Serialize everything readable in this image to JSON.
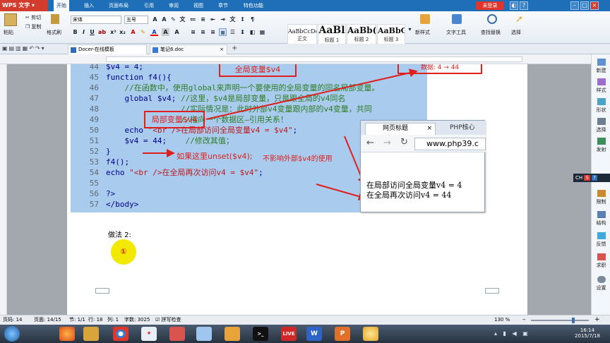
{
  "app": {
    "name": "WPS 文字",
    "unlogged": "未登录"
  },
  "menu": [
    "开始",
    "插入",
    "页面布局",
    "引用",
    "审阅",
    "视图",
    "章节",
    "特色功能"
  ],
  "ribbon": {
    "paste": "粘贴",
    "cut": "剪切",
    "copy": "复制",
    "format_painter": "格式刷",
    "font_name": "宋体",
    "font_size": "五号",
    "styles": [
      {
        "sample": "AaBbCcDd",
        "label": "正文"
      },
      {
        "sample": "AaBl",
        "label": "标题 1"
      },
      {
        "sample": "AaBb(",
        "label": "标题 2"
      },
      {
        "sample": "AaBbC",
        "label": "标题 3"
      }
    ],
    "new_style": "新样式",
    "text_tools": "文字工具",
    "find_replace": "查找替换",
    "select": "选择"
  },
  "tabs": [
    {
      "label": "Docer-在线模板"
    },
    {
      "label": "笔记6.doc"
    }
  ],
  "code_lines": [
    {
      "n": "44",
      "parts": [
        {
          "c": "kw",
          "t": "$v4 = 4;"
        }
      ]
    },
    {
      "n": "45",
      "parts": [
        {
          "c": "kw",
          "t": "function f4(){"
        }
      ]
    },
    {
      "n": "46",
      "parts": [
        {
          "c": "cm",
          "t": "    //在函数中，使用global来声明一个要使用的全局变量的同名局部变量。"
        }
      ]
    },
    {
      "n": "47",
      "parts": [
        {
          "c": "kw",
          "t": "    global $v4; "
        },
        {
          "c": "cm",
          "t": "//这里，$v4是局部变量，只是跟全局的v4同名"
        }
      ]
    },
    {
      "n": "48",
      "parts": [
        {
          "c": "cm",
          "t": "                //实际情况是：此时外部v4变量跟内部的v4变量，共同"
        }
      ]
    },
    {
      "n": "49",
      "parts": [
        {
          "c": "cm",
          "t": "                //指向一个数据区—引用关系！"
        }
      ]
    },
    {
      "n": "50",
      "parts": [
        {
          "c": "kw",
          "t": "    echo "
        },
        {
          "c": "st",
          "t": "\"<br />在局部访问全局变量v4 = $v4\""
        },
        {
          "c": "kw",
          "t": ";"
        }
      ]
    },
    {
      "n": "51",
      "parts": [
        {
          "c": "kw",
          "t": "    $v4 = 44;    "
        },
        {
          "c": "cm",
          "t": "//修改其值；"
        }
      ]
    },
    {
      "n": "52",
      "parts": [
        {
          "c": "kw",
          "t": "}"
        }
      ]
    },
    {
      "n": "53",
      "parts": [
        {
          "c": "kw",
          "t": "f4();"
        }
      ]
    },
    {
      "n": "54",
      "parts": [
        {
          "c": "kw",
          "t": "echo "
        },
        {
          "c": "st",
          "t": "\"<br />在全局再次访问v4 = $v4\""
        },
        {
          "c": "kw",
          "t": ";"
        }
      ]
    },
    {
      "n": "55",
      "parts": [
        {
          "c": "kw",
          "t": ""
        }
      ]
    },
    {
      "n": "56",
      "parts": [
        {
          "c": "kw",
          "t": "?>"
        }
      ]
    },
    {
      "n": "57",
      "parts": [
        {
          "c": "kw",
          "t": "</body>"
        }
      ]
    }
  ],
  "annotations": {
    "global_var": "全局变量$v4",
    "local_var": "局部变量$v4",
    "top_right": "数据: 4 → 44",
    "unset_hint": "如果这里unset($v4);",
    "unset_hint2": "不影响外部$v4的使用"
  },
  "browser": {
    "tab1": "网页标题",
    "tab2": "PHP核心",
    "url": "www.php39.c",
    "out1": "在局部访问全局变量v4 = 4",
    "out2": "在全局再次访问v4 = 44"
  },
  "doc": {
    "heading": "做法 2:",
    "cursor_mark": "①"
  },
  "sidebar": [
    "新建",
    "样式",
    "形状",
    "选择",
    "发射",
    "限制",
    "结构",
    "反馈",
    "求职",
    "设置"
  ],
  "ime": "CH",
  "status": {
    "page": "页码: 14",
    "pages": "页面: 14/15",
    "section": "节: 1/1",
    "row": "行: 18",
    "col": "列: 1",
    "words": "字数: 3025",
    "spell": "拼写检查",
    "zoom": "130 %"
  },
  "clock": {
    "time": "16:14",
    "date": "2015/7/18"
  },
  "taskbar": [
    "word-app",
    "ppt-app"
  ],
  "colors": {
    "code_bg": "#a9cbee",
    "annotation": "#e0201c",
    "titlebar": "#1f6fb8"
  }
}
